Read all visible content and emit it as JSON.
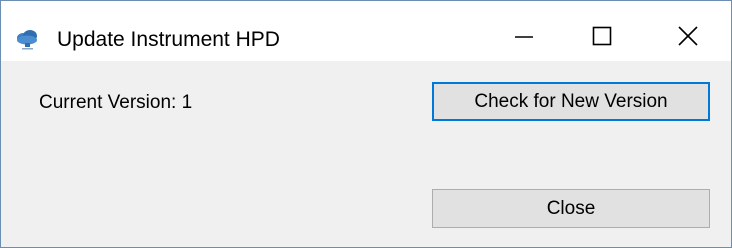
{
  "window": {
    "title": "Update Instrument HPD",
    "app_icon": "cloud-app-icon",
    "controls": {
      "minimize_icon": "minimize-icon",
      "maximize_icon": "maximize-icon",
      "close_icon": "close-icon"
    }
  },
  "content": {
    "current_version_label": "Current Version: 1",
    "check_button_label": "Check for New Version",
    "close_button_label": "Close"
  },
  "colors": {
    "focus_border": "#0078d7",
    "button_face": "#e1e1e1",
    "client_background": "#f0f0f0"
  }
}
